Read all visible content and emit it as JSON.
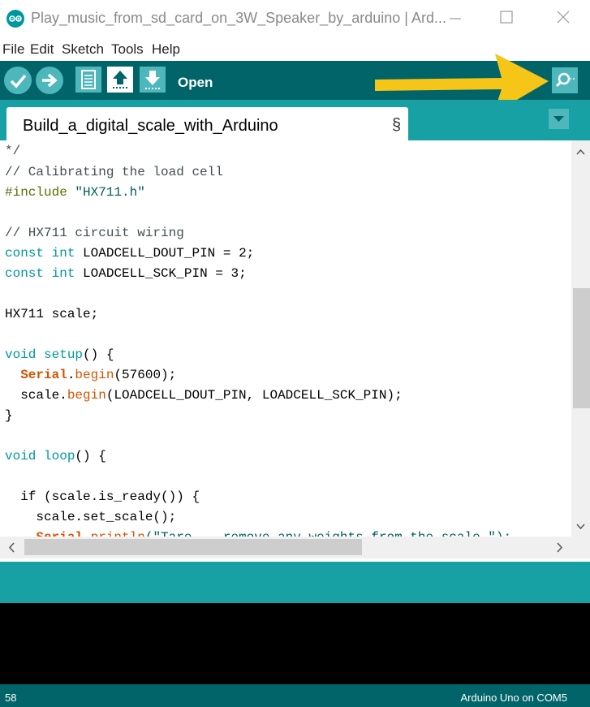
{
  "window": {
    "title": "Play_music_from_sd_card_on_3W_Speaker_by_arduino | Ard...",
    "icon": "arduino-logo-icon",
    "controls": [
      "minimize-icon",
      "maximize-icon",
      "close-icon"
    ]
  },
  "menu": [
    "File",
    "Edit",
    "Sketch",
    "Tools",
    "Help"
  ],
  "toolbar": {
    "buttons": [
      "verify-icon",
      "upload-icon",
      "new-icon",
      "open-icon",
      "save-icon",
      "serial-monitor-icon"
    ],
    "hover_label": "Open"
  },
  "tab": {
    "name": "Build_a_digital_scale_with_Arduino",
    "suffix": "§"
  },
  "code": [
    "*/",
    "// Calibrating the load cell",
    "#include \"HX711.h\"",
    "",
    "// HX711 circuit wiring",
    "const int LOADCELL_DOUT_PIN = 2;",
    "const int LOADCELL_SCK_PIN = 3;",
    "",
    "HX711 scale;",
    "",
    "void setup() {",
    "  Serial.begin(57600);",
    "  scale.begin(LOADCELL_DOUT_PIN, LOADCELL_SCK_PIN);",
    "}",
    "",
    "void loop() {",
    "",
    "  if (scale.is_ready()) {",
    "    scale.set_scale();",
    "    Serial.println(\"Tare... remove any weights from the scale.\");"
  ],
  "status": {
    "line_number": "58",
    "board": "Arduino Uno on COM5"
  },
  "colors": {
    "toolbar": "#006468",
    "tabbar": "#17a1a5",
    "button": "#4db7bb",
    "annotation_arrow": "#f5c518"
  }
}
